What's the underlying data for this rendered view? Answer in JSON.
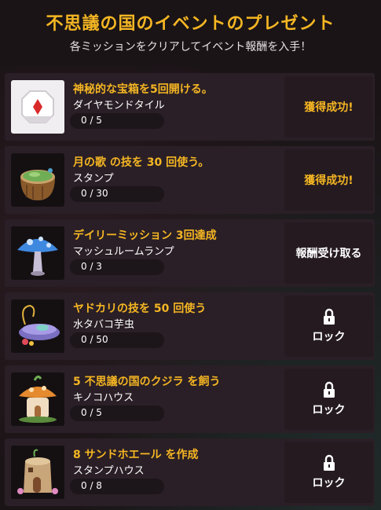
{
  "header": {
    "title": "不思議の国のイベントのプレゼント",
    "subtitle": "各ミッションをクリアしてイベント報酬を入手！"
  },
  "colors": {
    "accent": "#f5b623",
    "card": "#2a1f26",
    "background": "#1b1417"
  },
  "missions": [
    {
      "title": "神秘的な宝箱を5回開ける。",
      "reward": "ダイヤモンドタイル",
      "progress_text": "0 / 5",
      "progress": 0,
      "action": "獲得成功!",
      "state": "success",
      "icon": "diamond-tile-icon"
    },
    {
      "title": "月の歌 の技を 30 回使う。",
      "reward": "スタンプ",
      "progress_text": "0 / 30",
      "progress": 0,
      "action": "獲得成功!",
      "state": "success",
      "icon": "stump-icon"
    },
    {
      "title": "デイリーミッション 3回達成",
      "reward": "マッシュルームランプ",
      "progress_text": "0 / 3",
      "progress": 0,
      "action": "報酬受け取る",
      "state": "claim",
      "icon": "mushroom-lamp-icon"
    },
    {
      "title": "ヤドカリの技を 50 回使う",
      "reward": "水タバコ芋虫",
      "progress_text": "0 / 50",
      "progress": 0,
      "action": "ロック",
      "state": "locked",
      "icon": "hookah-caterpillar-icon"
    },
    {
      "title": "5 不思議の国のクジラ を飼う",
      "reward": "キノコハウス",
      "progress_text": "0 / 5",
      "progress": 0,
      "action": "ロック",
      "state": "locked",
      "icon": "mushroom-house-icon"
    },
    {
      "title": "8 サンドホエール を作成",
      "reward": "スタンプハウス",
      "progress_text": "0 / 8",
      "progress": 0,
      "action": "ロック",
      "state": "locked",
      "icon": "stump-house-icon"
    }
  ]
}
